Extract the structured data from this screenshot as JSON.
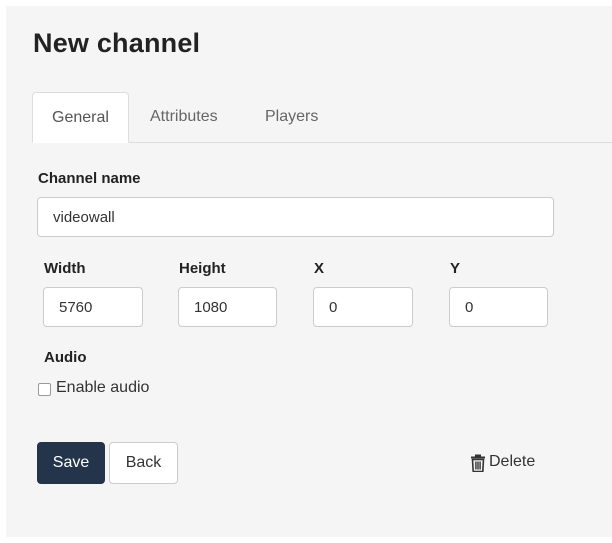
{
  "page": {
    "title": "New channel"
  },
  "tabs": [
    {
      "label": "General",
      "active": true
    },
    {
      "label": "Attributes",
      "active": false
    },
    {
      "label": "Players",
      "active": false
    }
  ],
  "form": {
    "channel_name": {
      "label": "Channel name",
      "value": "videowall"
    },
    "width": {
      "label": "Width",
      "value": "5760"
    },
    "height": {
      "label": "Height",
      "value": "1080"
    },
    "x": {
      "label": "X",
      "value": "0"
    },
    "y": {
      "label": "Y",
      "value": "0"
    },
    "audio": {
      "label": "Audio",
      "checkbox_label": "Enable audio",
      "checked": false
    }
  },
  "actions": {
    "save": "Save",
    "back": "Back",
    "delete": "Delete",
    "delete_icon": "trash-icon"
  },
  "colors": {
    "primary_button": "#23344b",
    "panel_background": "#f5f5f5"
  }
}
